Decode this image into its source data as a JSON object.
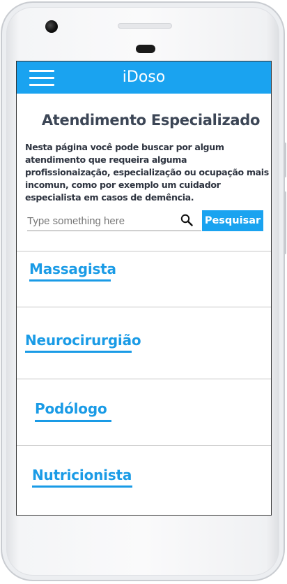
{
  "app": {
    "title": "iDoso"
  },
  "page": {
    "title": "Atendimento Especializado",
    "description": "Nesta página você pode buscar por algum atendimento que requeira alguma profissionaização, especialização ou ocupação mais incomun, como por exemplo um cuidador especialista em casos de demência."
  },
  "search": {
    "placeholder": "Type something here",
    "value": "",
    "button_label": "Pesquisar"
  },
  "categories": [
    {
      "label": "Massagista"
    },
    {
      "label": "Neurocirurgião"
    },
    {
      "label": "Podólogo"
    },
    {
      "label": "Nutricionista"
    }
  ],
  "colors": {
    "accent": "#1aa3f0",
    "link": "#1a9be6",
    "title": "#3c4656"
  },
  "icons": {
    "menu": "hamburger-menu-icon",
    "search": "search-icon"
  }
}
